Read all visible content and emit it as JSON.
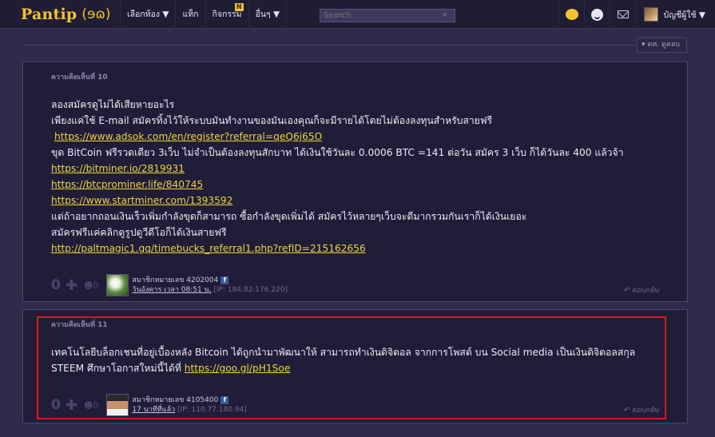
{
  "topbar": {
    "logo_text": "Pantip",
    "logo_mark": "(ɘɷ)",
    "nav": [
      {
        "label": "เลือกห้อง ▼"
      },
      {
        "label": "แท็ก"
      },
      {
        "label": "กิจกรรม",
        "badge": "N"
      },
      {
        "label": "อื่นๆ ▼"
      }
    ],
    "search_placeholder": "Search",
    "search_icon": "search-icon",
    "icons": [
      "smiley-face-icon",
      "emoji-icon",
      "mail-icon"
    ],
    "account_label": "บัญชีผู้ใช้ ▼"
  },
  "sort": {
    "label": "▾ คห. ดูคลบ"
  },
  "comments": [
    {
      "title": "ความคิดเห็นที่ 10",
      "lines": [
        {
          "text": "ลองสมัครดูไม่ได้เสียหายอะไร"
        },
        {
          "text": "เพียงแค่ใช้ E-mail สมัครทิ้งไว้ให้ระบบมันทำงานของมันเองคุณก็จะมีรายได้โดยไม่ต้องลงทุนสำหรับสายฟรี"
        },
        {
          "link": "https://www.adsok.com/en/register?referral=qeQ6j65O",
          "indent": true
        },
        {
          "text": "ขุด BitCoin ฟรีรวดเดียว 3เว็บ ไม่จำเป็นต้องลงทุนสักบาท ได้เงินใช้วันละ 0.0006 BTC =141 ต่อวัน สมัคร 3 เว็บ ก็ได้วันละ 400 แล้วจ้า"
        },
        {
          "link": "https://bitminer.io/2819931"
        },
        {
          "link": "https://btcprominer.life/840745"
        },
        {
          "link": "https://www.startminer.com/1393592"
        },
        {
          "text": "แต่ถ้าอยากถอนเงินเร็วเพิ่มกำลังขุดก็สามารถ ซื้อกำลังขุดเพิ่มได้ สมัครไว้หลายๆเว็บจะดีมากรวมกันเราก็ได้เงินเยอะ"
        },
        {
          "text": "สมัครฟรีแค่คลิกดูรูปดูวีดีโอก็ได้เงินสายฟรี"
        },
        {
          "link": "http://paltmagic1.gq/timebucks_referral1.php?refID=215162656"
        }
      ],
      "votes": "0",
      "emo_count": "0",
      "user": "สมาชิกหมายเลข 4202004",
      "time": "วันอังคาร เวลา 08:51 น.",
      "ip": "[IP: 184.82.176.220]",
      "reply": "ตอบกลับ"
    },
    {
      "title": "ความคิดเห็นที่ 11",
      "lines": [
        {
          "text": "เทคโนโลยีบล็อกเชนที่อยู่เบื้องหลัง Bitcoin ได้ถูกนำมาพัฒนาให้ สามารถทำเงินดิจิตอล จากการโพสต์ บน Social media เป็นเงินดิจิตอลสกุล"
        },
        {
          "text": "STEEM ศึกษาโอกาสใหม่นี้ได้ที่ ",
          "link": "https://goo.gl/pH1Soe"
        }
      ],
      "votes": "0",
      "emo_count": "0",
      "user": "สมาชิกหมายเลข 4105400",
      "time": "17 นาทีที่แล้ว",
      "ip": "[IP: 110.77.180.94]",
      "reply": "ตอบกลับ"
    }
  ],
  "colors": {
    "background": "#2f2c4b",
    "card": "#1f1d38",
    "link": "#f2d23a",
    "highlight": "#e0141e",
    "logo": "#f2c230"
  }
}
